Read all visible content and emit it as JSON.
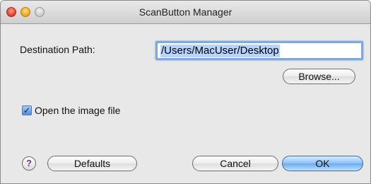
{
  "window": {
    "title": "ScanButton Manager"
  },
  "destination": {
    "label": "Destination Path:",
    "path_value": "/Users/MacUser/Desktop",
    "browse_label": "Browse..."
  },
  "options": {
    "open_image_label": "Open the image file",
    "open_image_checked": true
  },
  "footer": {
    "help_icon": "question-mark",
    "help_glyph": "?",
    "defaults_label": "Defaults",
    "cancel_label": "Cancel",
    "ok_label": "OK"
  },
  "colors": {
    "accent": "#6aaaf0",
    "help_glyph": "#6b2fa0",
    "selection": "#b5d5ff"
  }
}
